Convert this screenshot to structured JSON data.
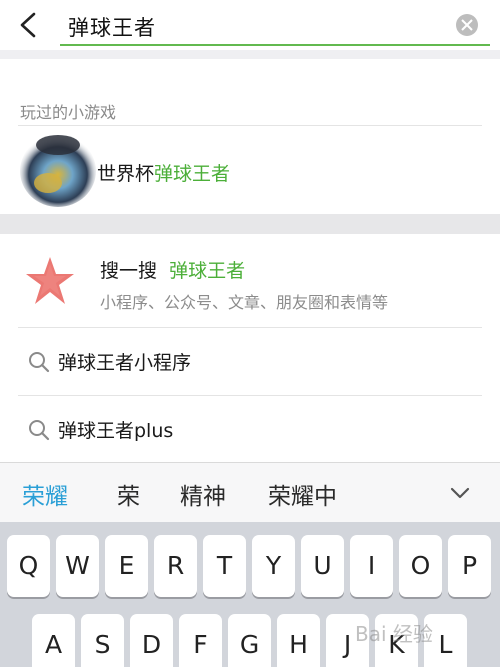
{
  "search": {
    "query": "弹球王者"
  },
  "played": {
    "title": "玩过的小游戏",
    "game_prefix": "世界杯",
    "game_highlight": "弹球王者"
  },
  "sousou": {
    "label": "搜一搜",
    "highlight": "弹球王者",
    "subtitle": "小程序、公众号、文章、朋友圈和表情等"
  },
  "suggestions": [
    {
      "text": "弹球王者小程序"
    },
    {
      "text": "弹球王者plus"
    }
  ],
  "ime": {
    "candidates": [
      "荣耀",
      "荣",
      "精神",
      "荣耀中"
    ],
    "active_color": "#2a9fd6"
  },
  "keyboard": {
    "row1": [
      "Q",
      "W",
      "E",
      "R",
      "T",
      "Y",
      "U",
      "I",
      "O",
      "P"
    ],
    "row2": [
      "A",
      "S",
      "D",
      "F",
      "G",
      "H",
      "J",
      "K",
      "L"
    ]
  },
  "watermark": "Bai 经验",
  "colors": {
    "accent_green": "#4caf39",
    "input_underline": "#62b94f"
  }
}
